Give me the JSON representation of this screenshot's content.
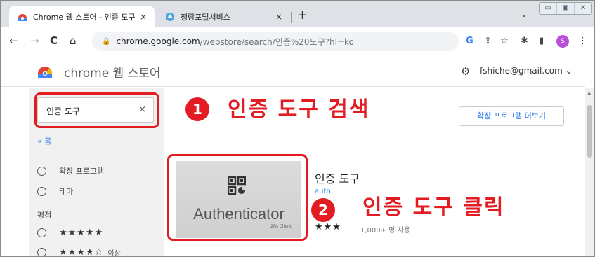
{
  "tabs": [
    {
      "title": "Chrome 웹 스토어 - 인증 도구",
      "close": "×"
    },
    {
      "title": "청람포털서비스",
      "close": "×"
    }
  ],
  "newtab": "+",
  "tab_overflow": "⌄",
  "window_controls": [
    "▭",
    "▣",
    "✕"
  ],
  "nav": {
    "back": "←",
    "forward": "→",
    "reload": "C",
    "home": "⌂"
  },
  "omnibox": {
    "lock": "🔒",
    "host": "chrome.google.com",
    "path": "/webstore/search/인증%20도구?hl=ko"
  },
  "toolbar_icons": {
    "google": "G",
    "share": "⇪",
    "star": "☆",
    "extensions": "✱",
    "sidepanel": "▮",
    "menu": "⋮"
  },
  "profile_initial": "S",
  "store": {
    "name": "chrome 웹 스토어",
    "email": "fshiche@gmail.com ⌄"
  },
  "sidebar": {
    "search_value": "인증 도구",
    "search_clear": "×",
    "home_link": "« 홈",
    "filters": [
      {
        "label": "확장 프로그램"
      },
      {
        "label": "테마"
      }
    ],
    "rating_heading": "평점",
    "ratings": [
      {
        "stars": "★★★★★",
        "suffix": ""
      },
      {
        "stars": "★★★★☆",
        "suffix": "이상"
      }
    ]
  },
  "main": {
    "more_button": "확장 프로그램 더보기",
    "result": {
      "title": "인증 도구",
      "publisher": "auth",
      "thumb_text": "Authenticator",
      "thumb_sub": "2FA Client",
      "stars": "★★★",
      "count": "1,000+ 명 사용"
    }
  },
  "annotations": [
    {
      "number": "1",
      "text": "인증 도구 검색"
    },
    {
      "number": "2",
      "text": "인증 도구 클릭"
    }
  ],
  "colors": {
    "accent_red": "#e31c23",
    "link_blue": "#1a73e8"
  }
}
